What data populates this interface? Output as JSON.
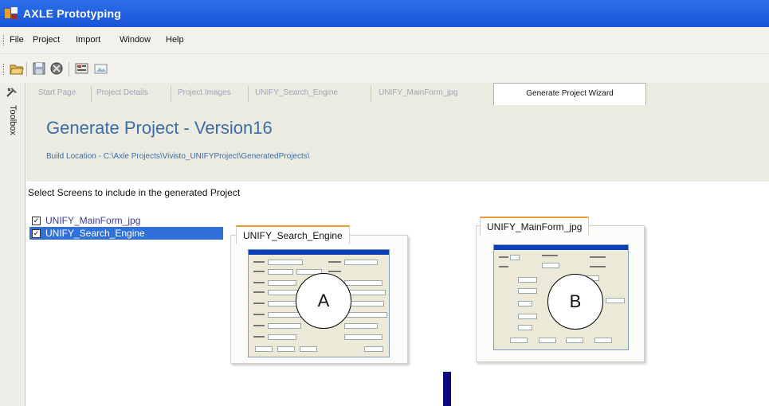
{
  "window": {
    "title": "AXLE Prototyping"
  },
  "menu": [
    {
      "label": "File"
    },
    {
      "label": "Project"
    },
    {
      "label": "Import"
    },
    {
      "label": "Window"
    },
    {
      "label": "Help"
    }
  ],
  "toolbox": {
    "label": "Toolbox"
  },
  "tabs": [
    {
      "label": "Start Page"
    },
    {
      "label": "Project Details"
    },
    {
      "label": "Project Images"
    },
    {
      "label": "UNIFY_Search_Engine"
    },
    {
      "label": "UNIFY_MainForm_jpg"
    }
  ],
  "active_tab": {
    "label": "Generate Project Wizard"
  },
  "page": {
    "title": "Generate Project - Version16",
    "build_location": "Build Location - C:\\Axle Projects\\Vivisto_UNIFYProject\\GeneratedProjects\\"
  },
  "instructions": "Select Screens to include in the generated Project",
  "screens": [
    {
      "label": "UNIFY_MainForm_jpg",
      "checked": true,
      "selected": false
    },
    {
      "label": "UNIFY_Search_Engine",
      "checked": true,
      "selected": true
    }
  ],
  "previews": [
    {
      "tab": "UNIFY_Search_Engine",
      "marker": "A"
    },
    {
      "tab": "UNIFY_MainForm_jpg",
      "marker": "B"
    }
  ],
  "colors": {
    "titlebar": "#1656d8",
    "accent": "#3c6ca7",
    "selection": "#3070d8",
    "tab_highlight": "#f09a33"
  }
}
